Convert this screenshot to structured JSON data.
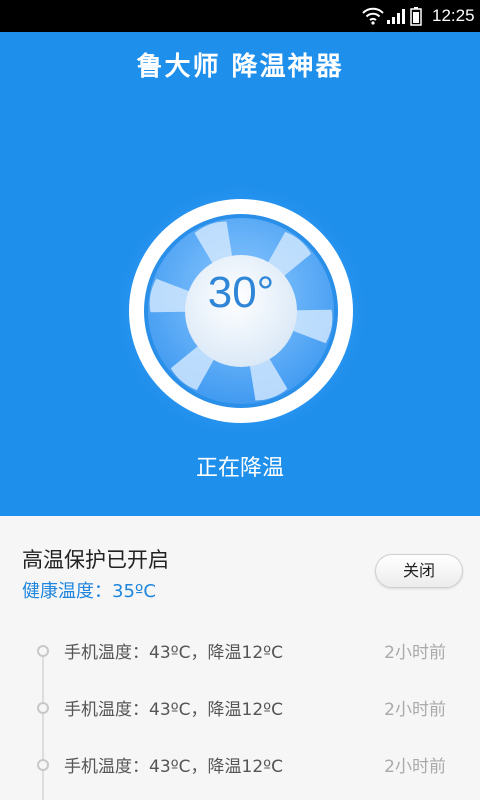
{
  "status_bar": {
    "time": "12:25",
    "icons": [
      "wifi-icon",
      "signal-icon",
      "battery-icon"
    ]
  },
  "header": {
    "title": "鲁大师 降温神器"
  },
  "gauge": {
    "temperature": "30°",
    "status": "正在降温",
    "icon": "fan-icon"
  },
  "protection": {
    "title": "高温保护已开启",
    "health_temp": "健康温度：35ºC",
    "close_label": "关闭"
  },
  "history": [
    {
      "text": "手机温度：43ºC，降温12ºC",
      "time": "2小时前"
    },
    {
      "text": "手机温度：43ºC，降温12ºC",
      "time": "2小时前"
    },
    {
      "text": "手机温度：43ºC，降温12ºC",
      "time": "2小时前"
    }
  ],
  "colors": {
    "primary_blue": "#1f8fec",
    "accent_text": "#1f86de",
    "panel_bg": "#f6f6f6"
  }
}
